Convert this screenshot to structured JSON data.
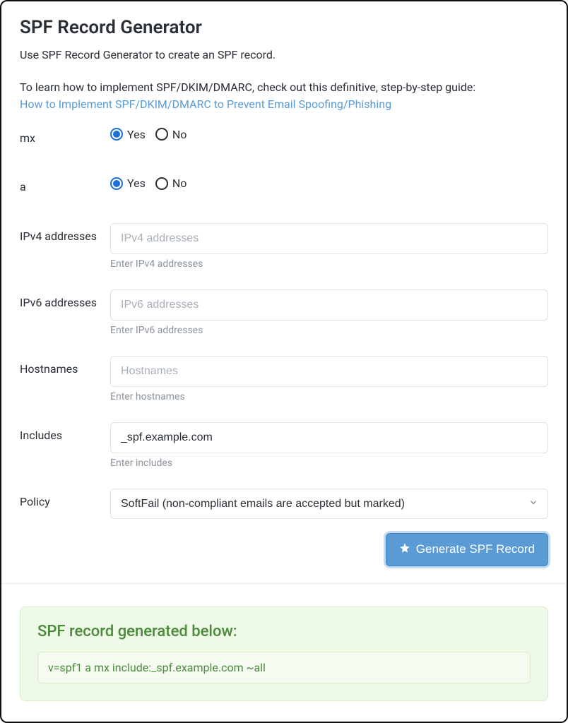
{
  "header": {
    "title": "SPF Record Generator",
    "intro_line1": "Use SPF Record Generator to create an SPF record.",
    "intro_line2_prefix": "To learn how to implement SPF/DKIM/DMARC, check out this definitive, step-by-step guide:",
    "intro_link": "How to Implement SPF/DKIM/DMARC to Prevent Email Spoofing/Phishing"
  },
  "form": {
    "mx": {
      "label": "mx",
      "yes": "Yes",
      "no": "No",
      "value": "yes"
    },
    "a": {
      "label": "a",
      "yes": "Yes",
      "no": "No",
      "value": "yes"
    },
    "ipv4": {
      "label": "IPv4 addresses",
      "placeholder": "IPv4 addresses",
      "value": "",
      "help": "Enter IPv4 addresses"
    },
    "ipv6": {
      "label": "IPv6 addresses",
      "placeholder": "IPv6 addresses",
      "value": "",
      "help": "Enter IPv6 addresses"
    },
    "hostnames": {
      "label": "Hostnames",
      "placeholder": "Hostnames",
      "value": "",
      "help": "Enter hostnames"
    },
    "includes": {
      "label": "Includes",
      "placeholder": "",
      "value": "_spf.example.com",
      "help": "Enter includes"
    },
    "policy": {
      "label": "Policy",
      "selected": "SoftFail (non-compliant emails are accepted but marked)"
    },
    "generate_button": "Generate SPF Record"
  },
  "result": {
    "title": "SPF record generated below:",
    "value": "v=spf1 a mx include:_spf.example.com ~all"
  }
}
